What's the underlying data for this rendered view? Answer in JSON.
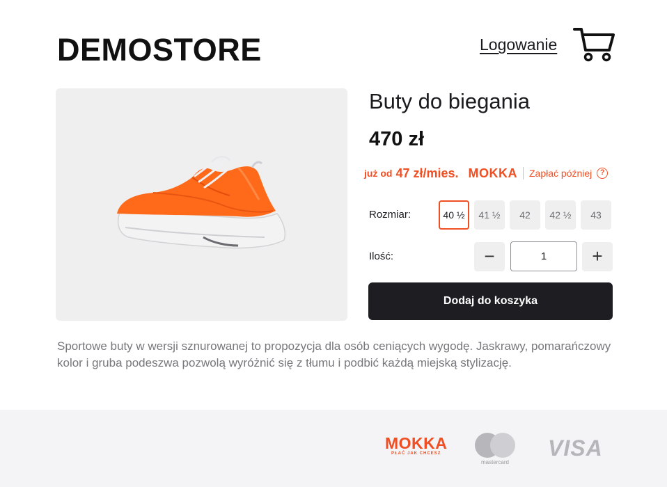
{
  "header": {
    "logo": "DEMOSTORE",
    "login_label": "Logowanie",
    "cart_icon": "cart-icon"
  },
  "product": {
    "title": "Buty do biegania",
    "price": "470 zł",
    "image_alt": "orange-sneaker",
    "description": "Sportowe buty w wersji sznurowanej to propozycja dla osób ceniących wygodę. Jaskrawy, pomarańczowy kolor i gruba podeszwa pozwolą wyróżnić się z tłumu i podbić każdą miejską stylizację."
  },
  "mokka": {
    "from_label": "już od",
    "amount": "47 zł/mies.",
    "brand": "MOKKA",
    "pay_later": "Zapłać później",
    "help_icon": "?"
  },
  "size": {
    "label": "Rozmiar:",
    "options": [
      "40 ½",
      "41 ½",
      "42",
      "42 ½",
      "43"
    ],
    "selected": "40 ½"
  },
  "quantity": {
    "label": "Ilość:",
    "value": "1",
    "minus": "−",
    "plus": "+"
  },
  "add_to_cart_label": "Dodaj do koszyka",
  "footer": {
    "mokka_brand": "MOKKA",
    "mokka_tagline": "PŁAĆ JAK CHCESZ",
    "mastercard_text": "mastercard",
    "visa": "VISA"
  },
  "colors": {
    "accent": "#f04e23",
    "button_dark": "#1e1d22",
    "image_bg": "#efeff0",
    "footer_bg": "#f4f4f6"
  }
}
